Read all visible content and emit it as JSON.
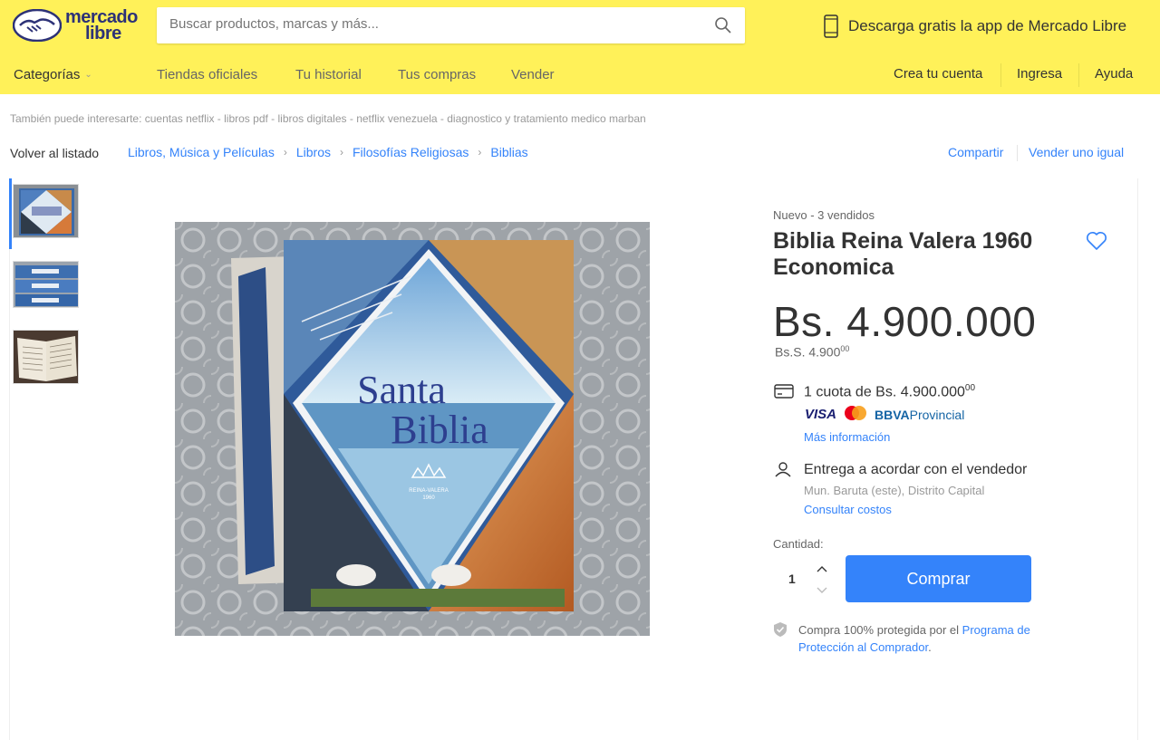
{
  "header": {
    "logo_line1": "mercado",
    "logo_line2": "libre",
    "search_placeholder": "Buscar productos, marcas y más...",
    "app_promo": "Descarga gratis la app de Mercado Libre",
    "categories_label": "Categorías",
    "nav": [
      "Tiendas oficiales",
      "Tu historial",
      "Tus compras",
      "Vender"
    ],
    "create_account": "Crea tu cuenta",
    "login": "Ingresa",
    "help": "Ayuda",
    "brand_color": "#fff159"
  },
  "suggestions": "También puede interesarte: cuentas netflix - libros pdf - libros digitales - netflix venezuela - diagnostico y tratamiento medico marban",
  "breadcrumb": {
    "back": "Volver al listado",
    "items": [
      "Libros, Música y Películas",
      "Libros",
      "Filosofías Religiosas",
      "Biblias"
    ],
    "share": "Compartir",
    "sell_same": "Vender uno igual"
  },
  "product": {
    "condition": "Nuevo  -  3 vendidos",
    "title": "Biblia Reina Valera 1960 Economica",
    "price": "Bs. 4.900.000",
    "price_alt": "Bs.S. 4.900",
    "price_alt_cents": "00",
    "installments": "1 cuota de Bs. 4.900.000",
    "installments_cents": "00",
    "payment_visa": "VISA",
    "payment_bank_bold": "BBVA",
    "payment_bank_rest": "Provincial",
    "more_info": "Más información",
    "delivery": "Entrega a acordar con el vendedor",
    "location": "Mun. Baruta (este), Distrito Capital",
    "check_costs": "Consultar costos",
    "quantity_label": "Cantidad:",
    "quantity": "1",
    "buy_label": "Comprar",
    "protection_text": "Compra 100% protegida por el ",
    "protection_link": "Programa de Protección al Comprador",
    "protection_end": ".",
    "image_title_line1": "Santa",
    "image_title_line2": "Biblia",
    "image_badge_line1": "REINA-VALERA",
    "image_badge_line2": "1960",
    "accent": "#3483fa"
  }
}
